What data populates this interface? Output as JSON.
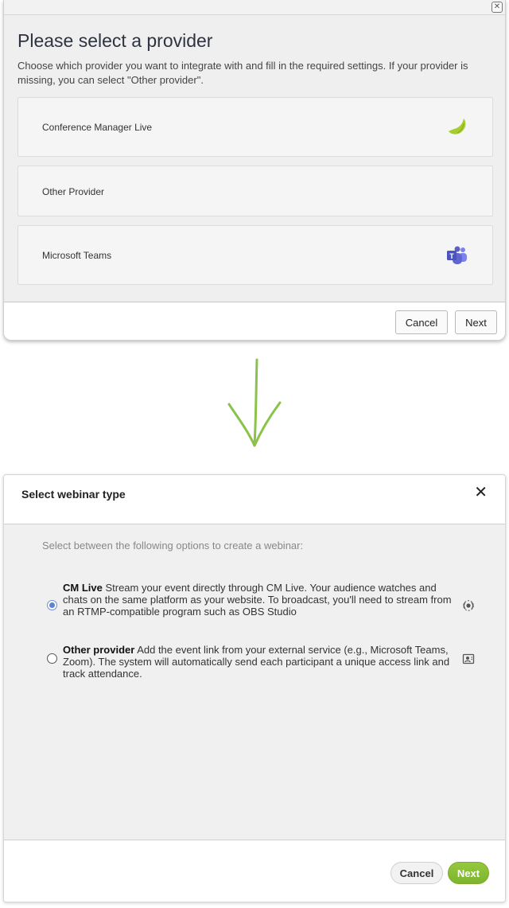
{
  "provider_dialog": {
    "title": "Please select a provider",
    "description": "Choose which provider you want to integrate with and fill in the required settings. If your provider is missing, you can select \"Other provider\".",
    "providers": [
      {
        "label": "Conference Manager Live",
        "icon": "cm-live-leaf-icon"
      },
      {
        "label": "Other Provider",
        "icon": ""
      },
      {
        "label": "Microsoft Teams",
        "icon": "microsoft-teams-icon"
      }
    ],
    "cancel_label": "Cancel",
    "next_label": "Next"
  },
  "webinar_dialog": {
    "title": "Select webinar type",
    "intro": "Select between the following options to create a webinar:",
    "options": [
      {
        "name": "CM Live",
        "description": "Stream your event directly through CM Live. Your audience watches and chats on the same platform as your website. To broadcast, you'll need to stream from an RTMP-compatible program such as OBS Studio",
        "selected": true,
        "icon": "broadcast-icon"
      },
      {
        "name": "Other provider",
        "description": "Add the event link from your external service (e.g., Microsoft Teams, Zoom). The system will automatically send each participant a unique access link and track attendance.",
        "selected": false,
        "icon": "contact-card-icon"
      }
    ],
    "cancel_label": "Cancel",
    "next_label": "Next"
  },
  "colors": {
    "accent_green": "#8bc34a",
    "radio_blue": "#5a84d8",
    "teams_purple": "#5b5fc7"
  }
}
